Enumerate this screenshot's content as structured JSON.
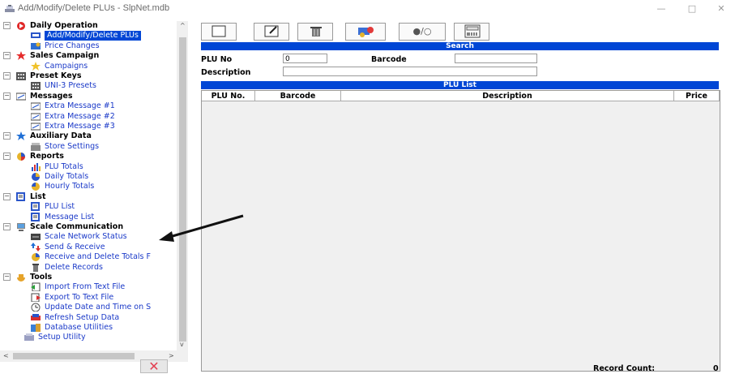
{
  "window": {
    "title": "Add/Modify/Delete PLUs - SlpNet.mdb",
    "minimize_glyph": "—",
    "maximize_glyph": "□",
    "close_glyph": "✕"
  },
  "tree": [
    {
      "label": "Daily Operation",
      "icon": "daily-operation-icon",
      "children": [
        {
          "label": "Add/Modify/Delete PLUs",
          "icon": "plu-icon",
          "selected": true
        },
        {
          "label": "Price Changes",
          "icon": "price-changes-icon"
        }
      ]
    },
    {
      "label": "Sales Campaign",
      "icon": "star-icon",
      "children": [
        {
          "label": "Campaigns",
          "icon": "campaign-star-icon"
        }
      ]
    },
    {
      "label": "Preset Keys",
      "icon": "keypad-icon",
      "children": [
        {
          "label": "UNI-3 Presets",
          "icon": "keypad-icon"
        }
      ]
    },
    {
      "label": "Messages",
      "icon": "message-icon",
      "children": [
        {
          "label": "Extra Message #1",
          "icon": "message-icon"
        },
        {
          "label": "Extra Message #2",
          "icon": "message-icon"
        },
        {
          "label": "Extra Message #3",
          "icon": "message-icon"
        }
      ]
    },
    {
      "label": "Auxiliary Data",
      "icon": "star-blue-icon",
      "children": [
        {
          "label": "Store Settings",
          "icon": "store-icon"
        }
      ]
    },
    {
      "label": "Reports",
      "icon": "reports-pie-icon",
      "children": [
        {
          "label": "PLU Totals",
          "icon": "bar-chart-icon"
        },
        {
          "label": "Daily Totals",
          "icon": "daily-totals-icon"
        },
        {
          "label": "Hourly Totals",
          "icon": "hourly-totals-icon"
        }
      ]
    },
    {
      "label": "List",
      "icon": "list-icon",
      "children": [
        {
          "label": "PLU List",
          "icon": "list-icon"
        },
        {
          "label": "Message List",
          "icon": "list-icon"
        }
      ]
    },
    {
      "label": "Scale Communication",
      "icon": "network-icon",
      "children": [
        {
          "label": "Scale Network Status",
          "icon": "network-status-icon"
        },
        {
          "label": "Send & Receive",
          "icon": "send-receive-icon"
        },
        {
          "label": "Receive and Delete Totals F",
          "icon": "receive-delete-icon"
        },
        {
          "label": "Delete Records",
          "icon": "trash-icon"
        }
      ]
    },
    {
      "label": "Tools",
      "icon": "tools-icon",
      "children": [
        {
          "label": "Import From Text File",
          "icon": "import-icon"
        },
        {
          "label": "Export To Text File",
          "icon": "export-icon"
        },
        {
          "label": "Update Date and Time on S",
          "icon": "clock-icon"
        },
        {
          "label": "Refresh Setup Data",
          "icon": "refresh-icon"
        },
        {
          "label": "Database Utilities",
          "icon": "database-icon"
        }
      ]
    },
    {
      "label": "Setup Utility",
      "icon": "setup-icon",
      "children": []
    }
  ],
  "tree_scroll": {
    "left": "<",
    "right": ">",
    "up": "^",
    "down": "v"
  },
  "close_button": "✕",
  "toolbar": [
    "new-document-icon",
    "edit-icon",
    "delete-icon",
    "transfer-icon",
    "toggle-icon",
    "barcode-label-icon"
  ],
  "toolbar_toggle_text": "●/○",
  "search": {
    "bar_label": "Search",
    "plu_no_label": "PLU No",
    "plu_no_value": "0",
    "barcode_label": "Barcode",
    "barcode_value": "",
    "description_label": "Description",
    "description_value": ""
  },
  "plu_list": {
    "bar_label": "PLU List",
    "columns": [
      "PLU No.",
      "Barcode",
      "Description",
      "Price"
    ],
    "rows": []
  },
  "record_count": {
    "label": "Record Count:",
    "value": "0"
  },
  "colors": {
    "accent": "#0046d5",
    "link": "#1a39c8",
    "close_red": "#e34152"
  }
}
